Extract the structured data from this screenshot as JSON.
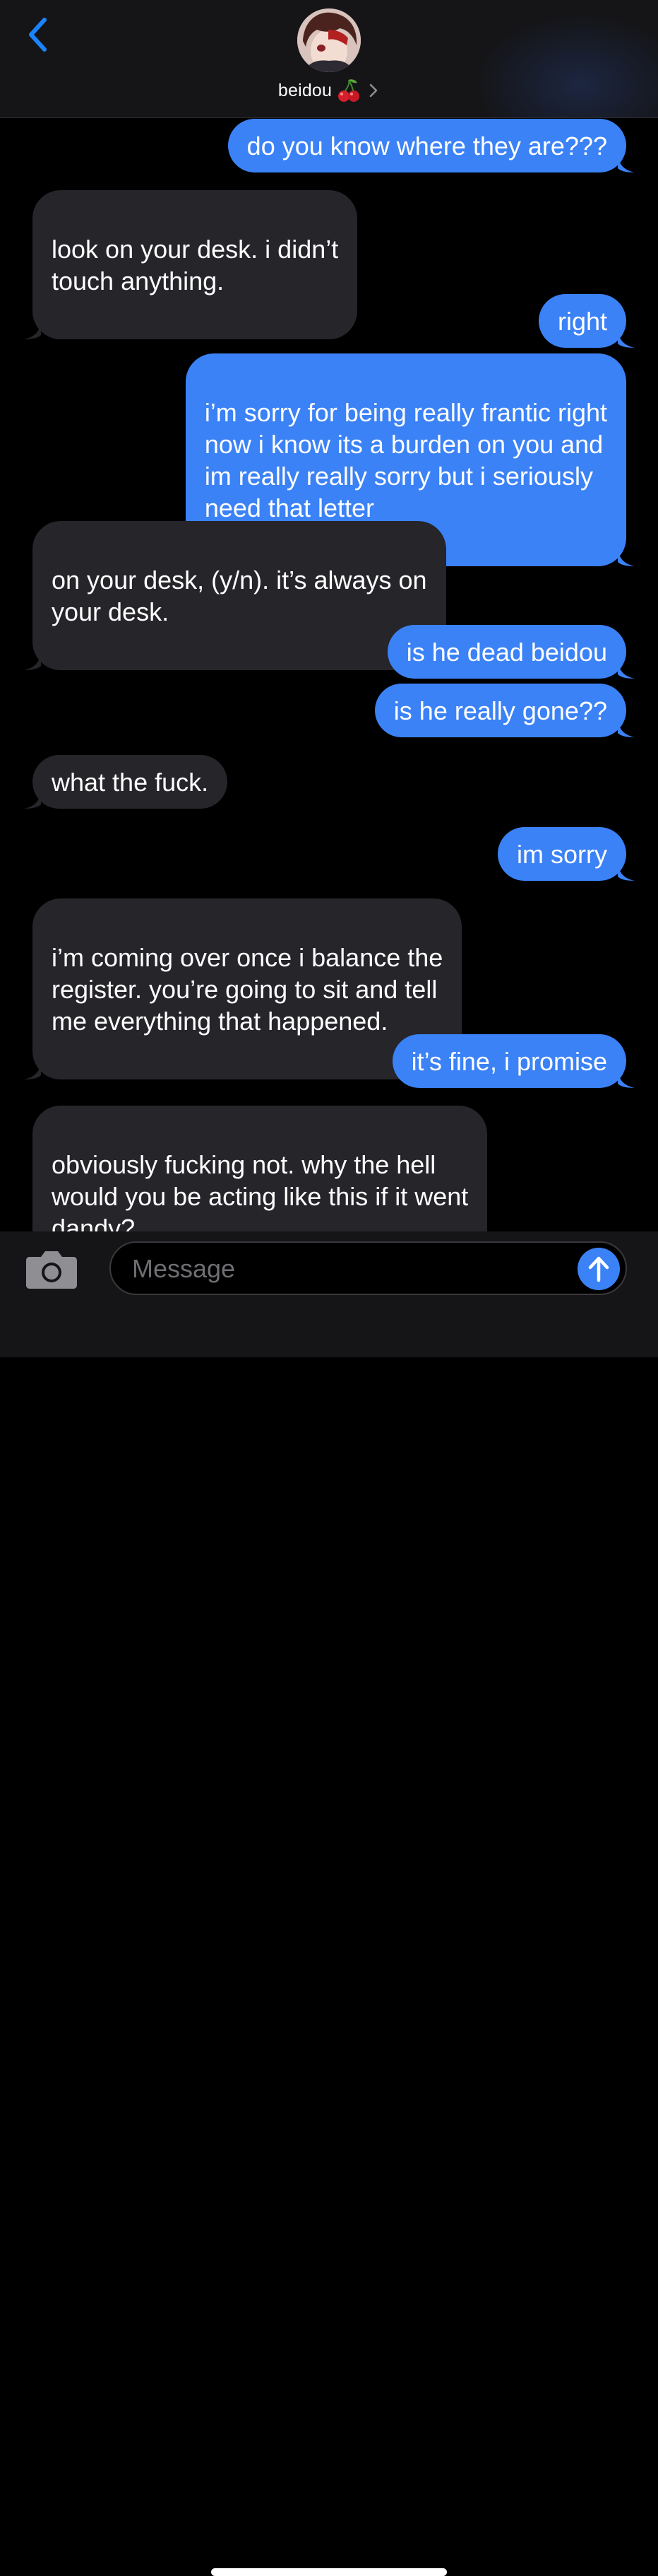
{
  "header": {
    "contact_name": "beidou",
    "contact_emoji": "cherries-icon",
    "back_icon": "chevron-left-icon",
    "detail_icon": "chevron-right-icon",
    "avatar": "contact-avatar"
  },
  "messages": [
    {
      "direction": "out",
      "text": "do you know where they are???"
    },
    {
      "direction": "in",
      "text": "look on your desk. i didn’t\ntouch anything."
    },
    {
      "direction": "out",
      "text": "right"
    },
    {
      "direction": "out",
      "text": "i’m sorry for being really frantic right\nnow i know its a burden on you and\nim really really sorry but i seriously\nneed that letter"
    },
    {
      "direction": "in",
      "text": "on your desk, (y/n). it’s always on\nyour desk."
    },
    {
      "direction": "out",
      "text": "is he dead beidou"
    },
    {
      "direction": "out",
      "text": "is he really gone??"
    },
    {
      "direction": "in",
      "text": "what the fuck."
    },
    {
      "direction": "out",
      "text": "im sorry"
    },
    {
      "direction": "in",
      "text": "i’m coming over once i balance the\nregister. you’re going to sit and tell\nme everything that happened."
    },
    {
      "direction": "out",
      "text": "it’s fine, i promise"
    },
    {
      "direction": "in",
      "text": "obviously fucking not. why the hell\nwould you be acting like this if it went\ndandy?"
    }
  ],
  "composer": {
    "placeholder": "Message",
    "value": "",
    "camera_icon": "camera-icon",
    "send_icon": "arrow-up-icon"
  },
  "colors": {
    "outgoing_bubble": "#3b82f7",
    "incoming_bubble": "#26252a",
    "accent": "#1a84ff",
    "background": "#000000",
    "bar_background": "#151518"
  }
}
